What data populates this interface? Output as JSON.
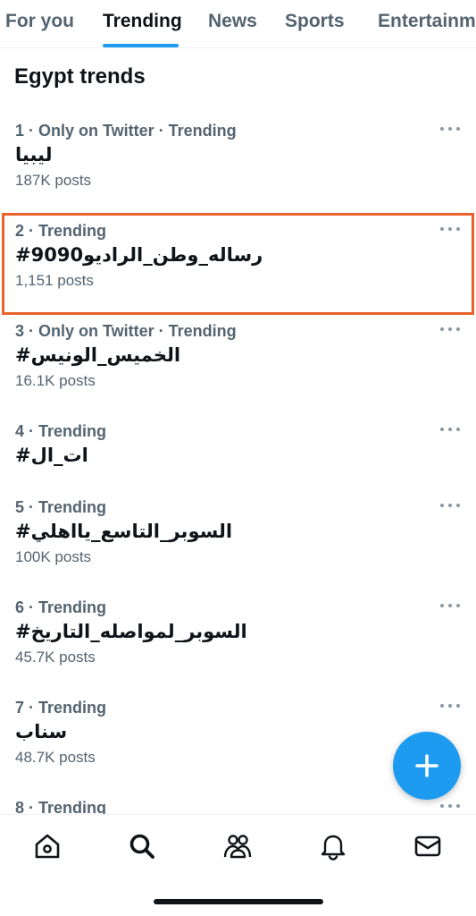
{
  "tabs": [
    {
      "label": "For you"
    },
    {
      "label": "Trending"
    },
    {
      "label": "News"
    },
    {
      "label": "Sports"
    },
    {
      "label": "Entertainme"
    }
  ],
  "active_tab": "Trending",
  "section_title": "Egypt trends",
  "trends": [
    {
      "meta": "1 · Only on Twitter · Trending",
      "name": "ليبيا",
      "posts": "187K posts"
    },
    {
      "meta": "2 · Trending",
      "name": "#رساله_وطن_الراديو9090",
      "posts": "1,151 posts"
    },
    {
      "meta": "3 · Only on Twitter · Trending",
      "name": "#الخميس_الونيس",
      "posts": "16.1K posts"
    },
    {
      "meta": "4 · Trending",
      "name": "#ات_ال",
      "posts": ""
    },
    {
      "meta": "5 · Trending",
      "name": "#السوبر_التاسع_يااهلي",
      "posts": "100K posts"
    },
    {
      "meta": "6 · Trending",
      "name": "#السوبر_لمواصله_التاريخ",
      "posts": "45.7K posts"
    },
    {
      "meta": "7 · Trending",
      "name": "سناب",
      "posts": "48.7K posts"
    },
    {
      "meta": "8 · Trending",
      "name": "",
      "posts": ""
    }
  ],
  "highlighted_trend": 2,
  "colors": {
    "accent": "#1d9bf0",
    "highlight_border": "#e8622a",
    "secondary_text": "#536471"
  },
  "bottom_nav": [
    {
      "icon": "home-icon"
    },
    {
      "icon": "search-icon"
    },
    {
      "icon": "communities-icon"
    },
    {
      "icon": "notifications-icon"
    },
    {
      "icon": "messages-icon"
    }
  ]
}
